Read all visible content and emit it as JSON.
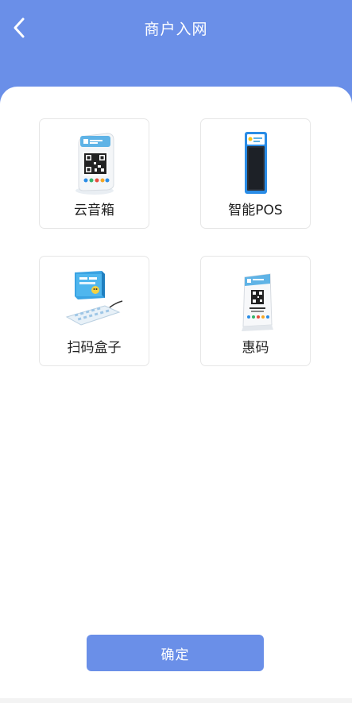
{
  "header": {
    "title": "商户入网",
    "back_icon": "chevron-left-icon"
  },
  "products": [
    {
      "label": "云音箱",
      "icon": "cloud-speaker-image"
    },
    {
      "label": "智能POS",
      "icon": "smart-pos-image"
    },
    {
      "label": "扫码盒子",
      "icon": "scan-box-image"
    },
    {
      "label": "惠码",
      "icon": "qr-stand-image"
    }
  ],
  "footer": {
    "confirm_label": "确定"
  },
  "colors": {
    "primary": "#6a8fe8",
    "background": "#ffffff",
    "tile_border": "#e6e6e6",
    "text": "#222222"
  }
}
